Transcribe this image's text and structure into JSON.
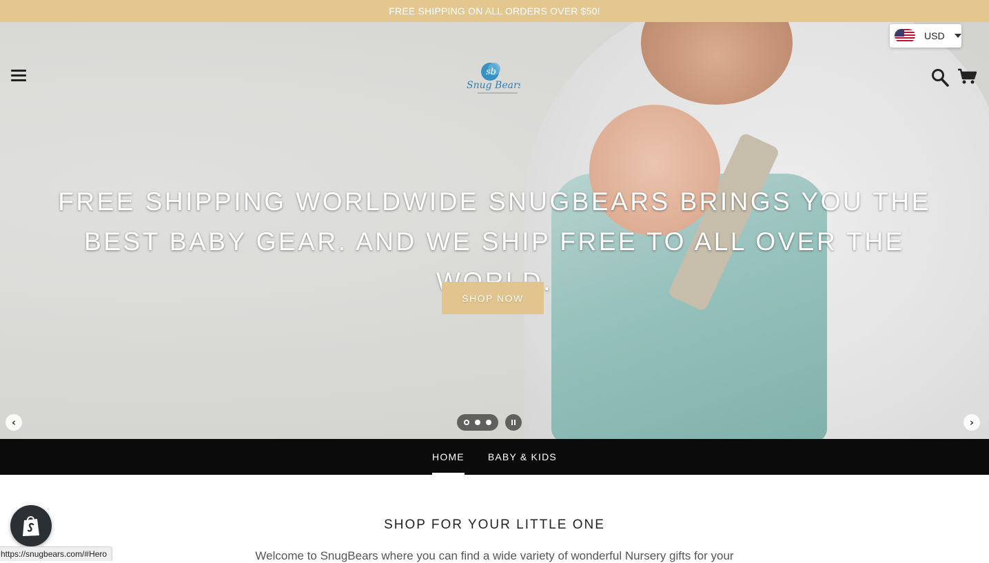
{
  "announcement": {
    "text": "FREE SHIPPING ON ALL ORDERS OVER $50!"
  },
  "currency": {
    "selected": "USD",
    "flag_icon": "us-flag-icon"
  },
  "header": {
    "menu_icon": "hamburger-menu-icon",
    "logo_icon": "snugbears-logo",
    "search_icon": "search-icon",
    "cart_icon": "cart-icon"
  },
  "hero": {
    "title": "FREE SHIPPING WORLDWIDE SNUGBEARS BRINGS YOU THE BEST BABY GEAR. AND WE SHIP FREE TO ALL OVER THE WORLD.",
    "cta_label": "SHOP NOW",
    "prev_label": "‹",
    "next_label": "›",
    "slides": 3,
    "active_slide": 1
  },
  "nav": {
    "items": [
      {
        "label": "HOME",
        "active": true
      },
      {
        "label": "BABY & KIDS",
        "active": false
      }
    ]
  },
  "section": {
    "title": "SHOP FOR YOUR LITTLE ONE",
    "text": "Welcome to SnugBears where you can find a wide variety of wonderful Nursery gifts for your"
  },
  "status_bar": {
    "url": "https://snugbears.com/#Hero"
  },
  "colors": {
    "announce_bg": "#e3c78f",
    "cta_bg": "#e2c58e",
    "nav_bg": "#0b0b0b"
  }
}
